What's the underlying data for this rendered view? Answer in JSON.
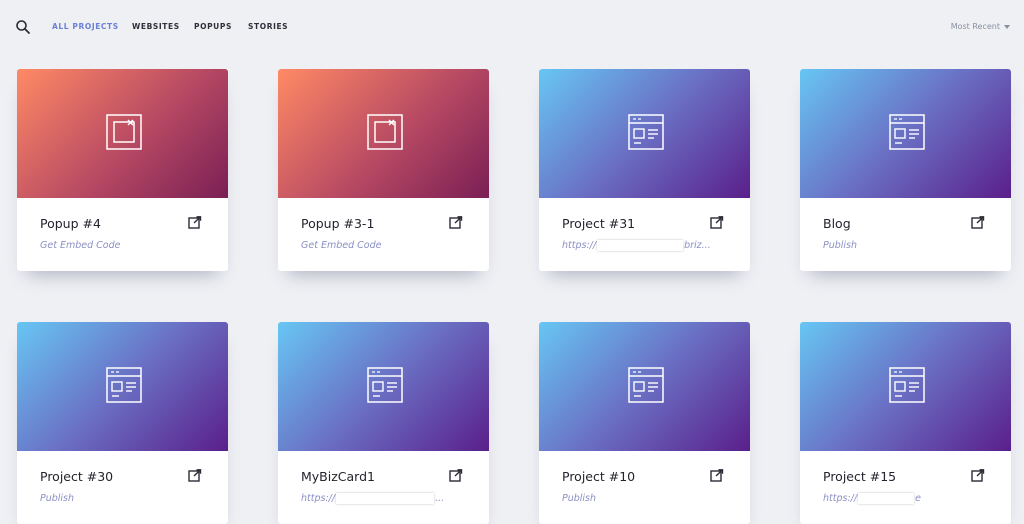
{
  "nav": {
    "tabs": [
      {
        "label": "ALL PROJECTS",
        "active": true
      },
      {
        "label": "WEBSITES",
        "active": false
      },
      {
        "label": "POPUPS",
        "active": false
      },
      {
        "label": "STORIES",
        "active": false
      }
    ],
    "sort_label": "Most Recent"
  },
  "colors": {
    "accent": "#6b7fd6",
    "subtitle": "#8b8fc4",
    "background": "#eef0f4"
  },
  "icons": {
    "search": "search-icon",
    "popup": "popup-window-icon",
    "website": "website-layout-icon",
    "external": "external-link-icon",
    "sort": "caret-down-icon"
  },
  "cards": [
    {
      "title": "Popup #4",
      "kind": "popup",
      "sub": "Get Embed Code"
    },
    {
      "title": "Popup #3-1",
      "kind": "popup",
      "sub": "Get Embed Code"
    },
    {
      "title": "Project #31",
      "kind": "website",
      "sub_prefix": "https://",
      "sub_suffix": "briz..."
    },
    {
      "title": "Blog",
      "kind": "website",
      "sub": "Publish"
    },
    {
      "title": "Project #30",
      "kind": "website",
      "sub": "Publish"
    },
    {
      "title": "MyBizCard1",
      "kind": "website",
      "sub_prefix": "https://",
      "sub_suffix": "..."
    },
    {
      "title": "Project #10",
      "kind": "website",
      "sub": "Publish"
    },
    {
      "title": "Project #15",
      "kind": "website",
      "sub_prefix": "https://",
      "sub_suffix": "e"
    }
  ]
}
